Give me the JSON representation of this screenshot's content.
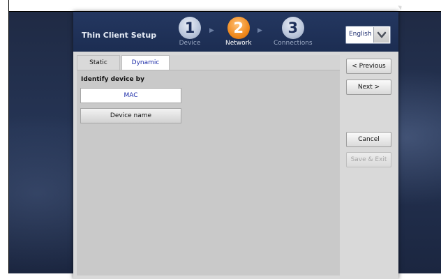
{
  "app": {
    "title": "Thin Client Setup"
  },
  "steps": [
    {
      "number": "1",
      "label": "Device"
    },
    {
      "number": "2",
      "label": "Network"
    },
    {
      "number": "3",
      "label": "Connections"
    }
  ],
  "active_step": "2",
  "language": {
    "selected": "English"
  },
  "tabs": {
    "static": "Static",
    "dynamic": "Dynamic"
  },
  "identify": {
    "label": "Identify device by",
    "options": [
      "MAC",
      "Device name"
    ]
  },
  "buttons": {
    "previous": "< Previous",
    "next": "Next >",
    "cancel": "Cancel",
    "save_exit": "Save & Exit"
  },
  "colors": {
    "titlebar": "#243760",
    "active_step": "#f08a1e",
    "link_text": "#1a2aa8"
  }
}
